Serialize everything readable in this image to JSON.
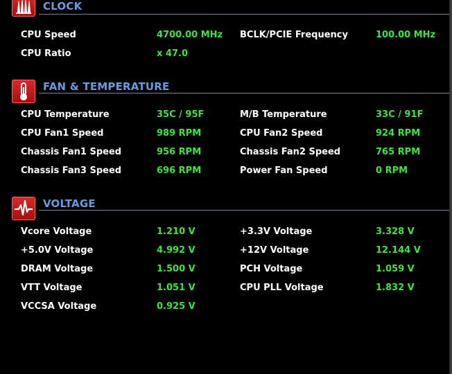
{
  "clock": {
    "title": "CLOCK",
    "icon": "clock-bars-icon",
    "rows": [
      {
        "l1": "CPU Speed",
        "v1": "4700.00 MHz",
        "l2": "BCLK/PCIE Frequency",
        "v2": "100.00 MHz"
      },
      {
        "l1": "CPU Ratio",
        "v1": "x 47.0",
        "l2": "",
        "v2": ""
      }
    ]
  },
  "fan": {
    "title": "FAN & TEMPERATURE",
    "icon": "thermometer-icon",
    "rows": [
      {
        "l1": "CPU Temperature",
        "v1": "35C / 95F",
        "l2": "M/B Temperature",
        "v2": "33C / 91F"
      },
      {
        "l1": "CPU Fan1 Speed",
        "v1": "989 RPM",
        "l2": "CPU Fan2 Speed",
        "v2": "924 RPM"
      },
      {
        "l1": "Chassis Fan1 Speed",
        "v1": "956 RPM",
        "l2": "Chassis Fan2 Speed",
        "v2": "765 RPM"
      },
      {
        "l1": "Chassis Fan3 Speed",
        "v1": "696 RPM",
        "l2": "Power Fan Speed",
        "v2": "0 RPM"
      }
    ]
  },
  "voltage": {
    "title": "VOLTAGE",
    "icon": "heartbeat-icon",
    "rows": [
      {
        "l1": "Vcore Voltage",
        "v1": "1.210 V",
        "l2": "+3.3V Voltage",
        "v2": "3.328 V"
      },
      {
        "l1": "+5.0V Voltage",
        "v1": "4.992 V",
        "l2": "+12V Voltage",
        "v2": "12.144 V"
      },
      {
        "l1": "DRAM Voltage",
        "v1": "1.500 V",
        "l2": "PCH Voltage",
        "v2": "1.059 V"
      },
      {
        "l1": "VTT Voltage",
        "v1": "1.051 V",
        "l2": "CPU PLL Voltage",
        "v2": "1.832 V"
      },
      {
        "l1": "VCCSA Voltage",
        "v1": "0.925 V",
        "l2": "",
        "v2": ""
      }
    ]
  },
  "colors": {
    "label": "#ffffff",
    "value": "#3ee53e",
    "header": "#6a9ae0",
    "icon_bg": "#c81e1e"
  }
}
